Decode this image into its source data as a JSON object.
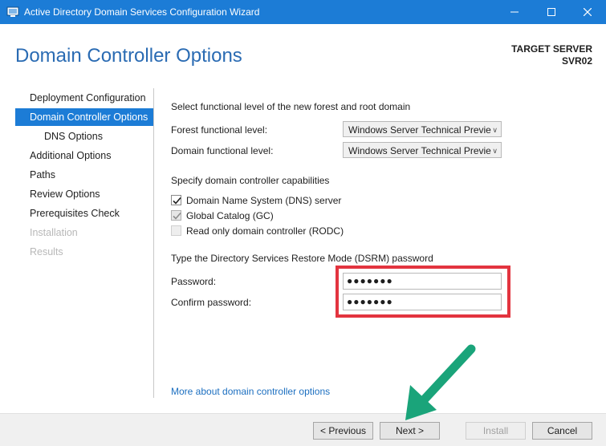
{
  "window": {
    "title": "Active Directory Domain Services Configuration Wizard"
  },
  "header": {
    "page_title": "Domain Controller Options",
    "target_server_label": "TARGET SERVER",
    "target_server_name": "SVR02"
  },
  "nav": {
    "items": [
      {
        "label": "Deployment Configuration",
        "state": "normal"
      },
      {
        "label": "Domain Controller Options",
        "state": "active"
      },
      {
        "label": "DNS Options",
        "state": "sub"
      },
      {
        "label": "Additional Options",
        "state": "normal"
      },
      {
        "label": "Paths",
        "state": "normal"
      },
      {
        "label": "Review Options",
        "state": "normal"
      },
      {
        "label": "Prerequisites Check",
        "state": "normal"
      },
      {
        "label": "Installation",
        "state": "disabled"
      },
      {
        "label": "Results",
        "state": "disabled"
      }
    ]
  },
  "main": {
    "functional_heading": "Select functional level of the new forest and root domain",
    "forest_label": "Forest functional level:",
    "forest_value": "Windows Server Technical Previe",
    "domain_label": "Domain functional level:",
    "domain_value": "Windows Server Technical Previe",
    "capabilities_heading": "Specify domain controller capabilities",
    "capabilities": [
      {
        "label": "Domain Name System (DNS) server",
        "checked": true,
        "enabled": true
      },
      {
        "label": "Global Catalog (GC)",
        "checked": true,
        "enabled": false
      },
      {
        "label": "Read only domain controller (RODC)",
        "checked": false,
        "enabled": false
      }
    ],
    "dsrm_heading": "Type the Directory Services Restore Mode (DSRM) password",
    "password_label": "Password:",
    "password_value": "●●●●●●●",
    "confirm_label": "Confirm password:",
    "confirm_value": "●●●●●●●",
    "more_link": "More about domain controller options"
  },
  "footer": {
    "previous": "< Previous",
    "next": "Next >",
    "install": "Install",
    "cancel": "Cancel"
  },
  "colors": {
    "accent": "#1c7cd6",
    "highlight": "#e3343f",
    "arrow": "#1aa47a"
  }
}
